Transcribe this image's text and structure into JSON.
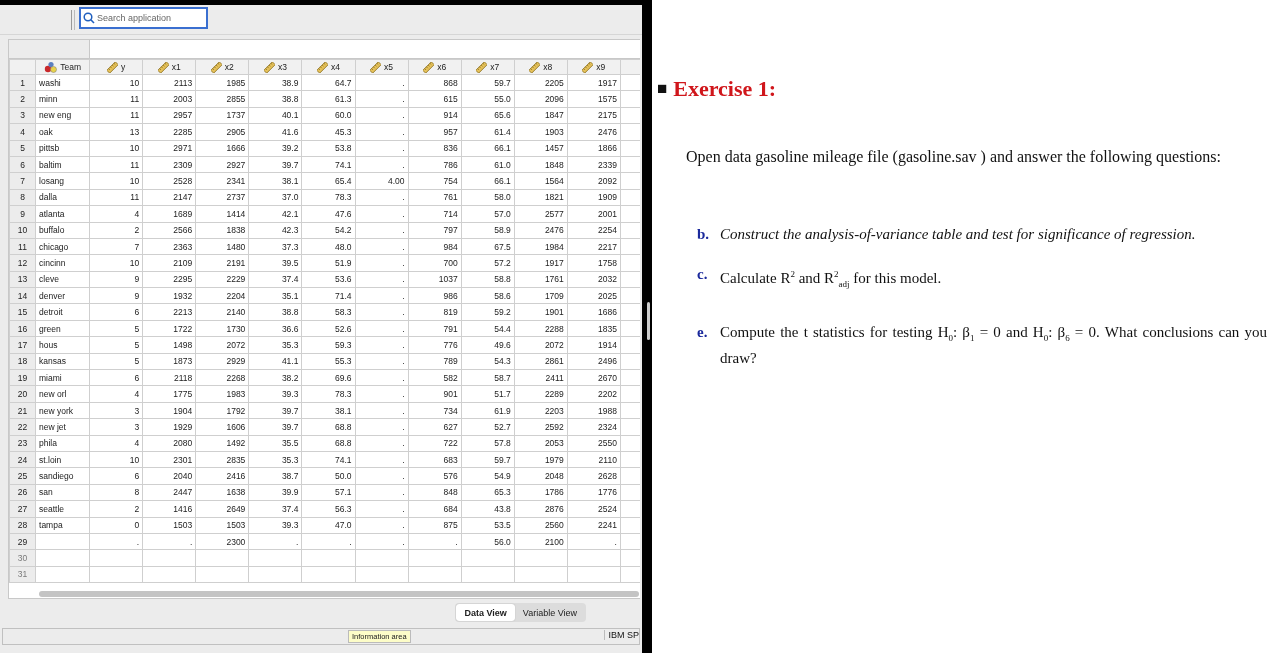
{
  "search": {
    "placeholder": "Search application"
  },
  "table": {
    "columns": [
      {
        "name": "Team",
        "kind": "nominal"
      },
      {
        "name": "y",
        "kind": "scale"
      },
      {
        "name": "x1",
        "kind": "scale"
      },
      {
        "name": "x2",
        "kind": "scale"
      },
      {
        "name": "x3",
        "kind": "scale"
      },
      {
        "name": "x4",
        "kind": "scale"
      },
      {
        "name": "x5",
        "kind": "scale"
      },
      {
        "name": "x6",
        "kind": "scale"
      },
      {
        "name": "x7",
        "kind": "scale"
      },
      {
        "name": "x8",
        "kind": "scale"
      },
      {
        "name": "x9",
        "kind": "scale"
      }
    ],
    "rows": [
      {
        "number": "1",
        "in_use": true,
        "cells": [
          "washi",
          "10",
          "2113",
          "1985",
          "38.9",
          "64.7",
          ".",
          "868",
          "59.7",
          "2205",
          "1917"
        ]
      },
      {
        "number": "2",
        "in_use": true,
        "cells": [
          "minn",
          "11",
          "2003",
          "2855",
          "38.8",
          "61.3",
          ".",
          "615",
          "55.0",
          "2096",
          "1575"
        ]
      },
      {
        "number": "3",
        "in_use": true,
        "cells": [
          "new eng",
          "11",
          "2957",
          "1737",
          "40.1",
          "60.0",
          ".",
          "914",
          "65.6",
          "1847",
          "2175"
        ]
      },
      {
        "number": "4",
        "in_use": true,
        "cells": [
          "oak",
          "13",
          "2285",
          "2905",
          "41.6",
          "45.3",
          ".",
          "957",
          "61.4",
          "1903",
          "2476"
        ]
      },
      {
        "number": "5",
        "in_use": true,
        "cells": [
          "pittsb",
          "10",
          "2971",
          "1666",
          "39.2",
          "53.8",
          ".",
          "836",
          "66.1",
          "1457",
          "1866"
        ]
      },
      {
        "number": "6",
        "in_use": true,
        "cells": [
          "baltim",
          "11",
          "2309",
          "2927",
          "39.7",
          "74.1",
          ".",
          "786",
          "61.0",
          "1848",
          "2339"
        ]
      },
      {
        "number": "7",
        "in_use": true,
        "cells": [
          "losang",
          "10",
          "2528",
          "2341",
          "38.1",
          "65.4",
          "4.00",
          "754",
          "66.1",
          "1564",
          "2092"
        ]
      },
      {
        "number": "8",
        "in_use": true,
        "cells": [
          "dalla",
          "11",
          "2147",
          "2737",
          "37.0",
          "78.3",
          ".",
          "761",
          "58.0",
          "1821",
          "1909"
        ]
      },
      {
        "number": "9",
        "in_use": true,
        "cells": [
          "atlanta",
          "4",
          "1689",
          "1414",
          "42.1",
          "47.6",
          ".",
          "714",
          "57.0",
          "2577",
          "2001"
        ]
      },
      {
        "number": "10",
        "in_use": true,
        "cells": [
          "buffalo",
          "2",
          "2566",
          "1838",
          "42.3",
          "54.2",
          ".",
          "797",
          "58.9",
          "2476",
          "2254"
        ]
      },
      {
        "number": "11",
        "in_use": true,
        "cells": [
          "chicago",
          "7",
          "2363",
          "1480",
          "37.3",
          "48.0",
          ".",
          "984",
          "67.5",
          "1984",
          "2217"
        ]
      },
      {
        "number": "12",
        "in_use": true,
        "cells": [
          "cincinn",
          "10",
          "2109",
          "2191",
          "39.5",
          "51.9",
          ".",
          "700",
          "57.2",
          "1917",
          "1758"
        ]
      },
      {
        "number": "13",
        "in_use": true,
        "cells": [
          "cleve",
          "9",
          "2295",
          "2229",
          "37.4",
          "53.6",
          ".",
          "1037",
          "58.8",
          "1761",
          "2032"
        ]
      },
      {
        "number": "14",
        "in_use": true,
        "cells": [
          "denver",
          "9",
          "1932",
          "2204",
          "35.1",
          "71.4",
          ".",
          "986",
          "58.6",
          "1709",
          "2025"
        ]
      },
      {
        "number": "15",
        "in_use": true,
        "cells": [
          "detroit",
          "6",
          "2213",
          "2140",
          "38.8",
          "58.3",
          ".",
          "819",
          "59.2",
          "1901",
          "1686"
        ]
      },
      {
        "number": "16",
        "in_use": true,
        "cells": [
          "green",
          "5",
          "1722",
          "1730",
          "36.6",
          "52.6",
          ".",
          "791",
          "54.4",
          "2288",
          "1835"
        ]
      },
      {
        "number": "17",
        "in_use": true,
        "cells": [
          "hous",
          "5",
          "1498",
          "2072",
          "35.3",
          "59.3",
          ".",
          "776",
          "49.6",
          "2072",
          "1914"
        ]
      },
      {
        "number": "18",
        "in_use": true,
        "cells": [
          "kansas",
          "5",
          "1873",
          "2929",
          "41.1",
          "55.3",
          ".",
          "789",
          "54.3",
          "2861",
          "2496"
        ]
      },
      {
        "number": "19",
        "in_use": true,
        "cells": [
          "miami",
          "6",
          "2118",
          "2268",
          "38.2",
          "69.6",
          ".",
          "582",
          "58.7",
          "2411",
          "2670"
        ]
      },
      {
        "number": "20",
        "in_use": true,
        "cells": [
          "new orl",
          "4",
          "1775",
          "1983",
          "39.3",
          "78.3",
          ".",
          "901",
          "51.7",
          "2289",
          "2202"
        ]
      },
      {
        "number": "21",
        "in_use": true,
        "cells": [
          "new york",
          "3",
          "1904",
          "1792",
          "39.7",
          "38.1",
          ".",
          "734",
          "61.9",
          "2203",
          "1988"
        ]
      },
      {
        "number": "22",
        "in_use": true,
        "cells": [
          "new jet",
          "3",
          "1929",
          "1606",
          "39.7",
          "68.8",
          ".",
          "627",
          "52.7",
          "2592",
          "2324"
        ]
      },
      {
        "number": "23",
        "in_use": true,
        "cells": [
          "phila",
          "4",
          "2080",
          "1492",
          "35.5",
          "68.8",
          ".",
          "722",
          "57.8",
          "2053",
          "2550"
        ]
      },
      {
        "number": "24",
        "in_use": true,
        "cells": [
          "st.loin",
          "10",
          "2301",
          "2835",
          "35.3",
          "74.1",
          ".",
          "683",
          "59.7",
          "1979",
          "2110"
        ]
      },
      {
        "number": "25",
        "in_use": true,
        "cells": [
          "sandiego",
          "6",
          "2040",
          "2416",
          "38.7",
          "50.0",
          ".",
          "576",
          "54.9",
          "2048",
          "2628"
        ]
      },
      {
        "number": "26",
        "in_use": true,
        "cells": [
          "san",
          "8",
          "2447",
          "1638",
          "39.9",
          "57.1",
          ".",
          "848",
          "65.3",
          "1786",
          "1776"
        ]
      },
      {
        "number": "27",
        "in_use": true,
        "cells": [
          "seattle",
          "2",
          "1416",
          "2649",
          "37.4",
          "56.3",
          ".",
          "684",
          "43.8",
          "2876",
          "2524"
        ]
      },
      {
        "number": "28",
        "in_use": true,
        "cells": [
          "tampa",
          "0",
          "1503",
          "1503",
          "39.3",
          "47.0",
          ".",
          "875",
          "53.5",
          "2560",
          "2241"
        ]
      },
      {
        "number": "29",
        "in_use": true,
        "cells": [
          null,
          ".",
          ".",
          "2300",
          ".",
          ".",
          ".",
          ".",
          "56.0",
          "2100",
          "."
        ]
      },
      {
        "number": "30",
        "in_use": false
      },
      {
        "number": "31",
        "in_use": false
      }
    ]
  },
  "view_tabs": [
    {
      "label": "Data View",
      "selected": true
    },
    {
      "label": "Variable View",
      "selected": false
    }
  ],
  "tooltip": "Information area",
  "status_bar": {
    "text": "IBM SP"
  },
  "exercise": {
    "bullet": "■",
    "title": "Exercise 1:",
    "intro": "Open data gasoline mileage file (gasoline.sav )  and answer the following questions:",
    "items": [
      {
        "letter": "b.",
        "text": "Construct the analysis-of-variance table and test for significance of regression.",
        "italic": true
      },
      {
        "letter": "c.",
        "text": "Calculate R$^{2}$ and R$^{2}$$_{adj}$ for this model.",
        "italic": false
      },
      {
        "letter": "e.",
        "text": "Compute the t statistics for testing H$_{0}$: β$_{1}$ = 0 and H$_{0}$: β$_{6}$ = 0. What conclusions can you draw?",
        "italic": false
      }
    ]
  }
}
